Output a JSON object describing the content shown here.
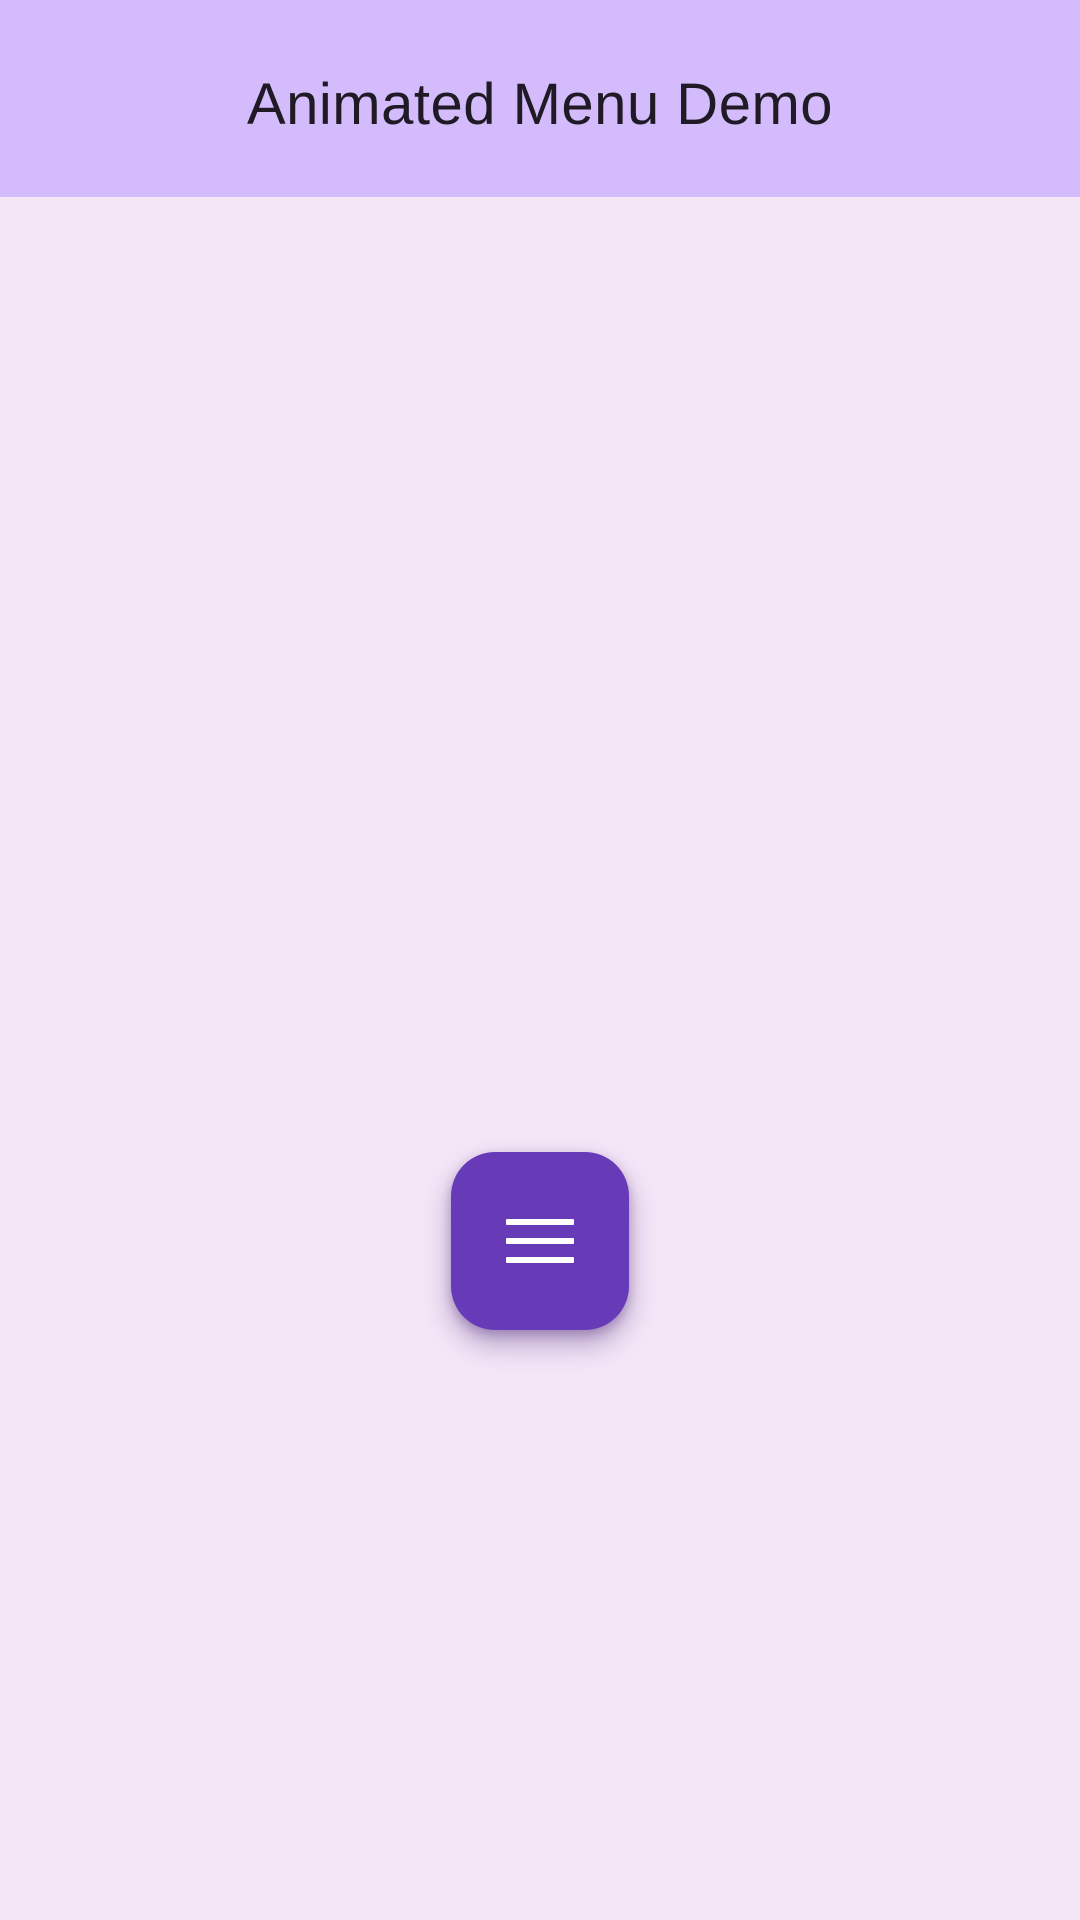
{
  "app": {
    "title": "Animated Menu Demo"
  },
  "fab": {
    "icon": "menu-icon"
  },
  "colors": {
    "background": "#F4E5F7",
    "app_bar": "#D4BCFC",
    "fab": "#673AB7",
    "fab_icon": "#FFFFFF",
    "title_text": "#1F1A26"
  }
}
